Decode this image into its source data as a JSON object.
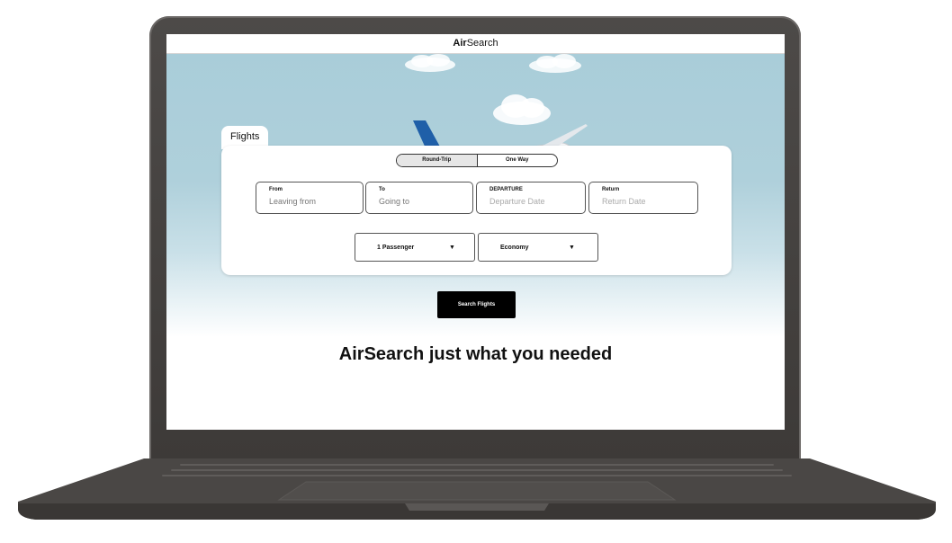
{
  "app": {
    "brand_bold": "Air",
    "brand_rest": "Search"
  },
  "search": {
    "tab_label": "Flights",
    "trip_options": [
      "Round-Trip",
      "One Way"
    ],
    "selected_trip": "Round-Trip",
    "fields": [
      {
        "label": "From",
        "placeholder": "Leaving from"
      },
      {
        "label": "To",
        "placeholder": "Going to"
      },
      {
        "label": "DEPARTURE",
        "placeholder": "Departure Date"
      },
      {
        "label": "Return",
        "placeholder": "Return Date"
      }
    ],
    "passengers": "1 Passenger",
    "cabin_class": "Economy",
    "button_label": "Search Flights"
  },
  "tagline": "AirSearch just what you needed",
  "colors": {
    "sky": "#a9cdd9",
    "button_bg": "#000000",
    "laptop_body": "#454240"
  },
  "icons": {
    "dropdown": "caret-down-icon",
    "hero": "airplane-illustration"
  }
}
